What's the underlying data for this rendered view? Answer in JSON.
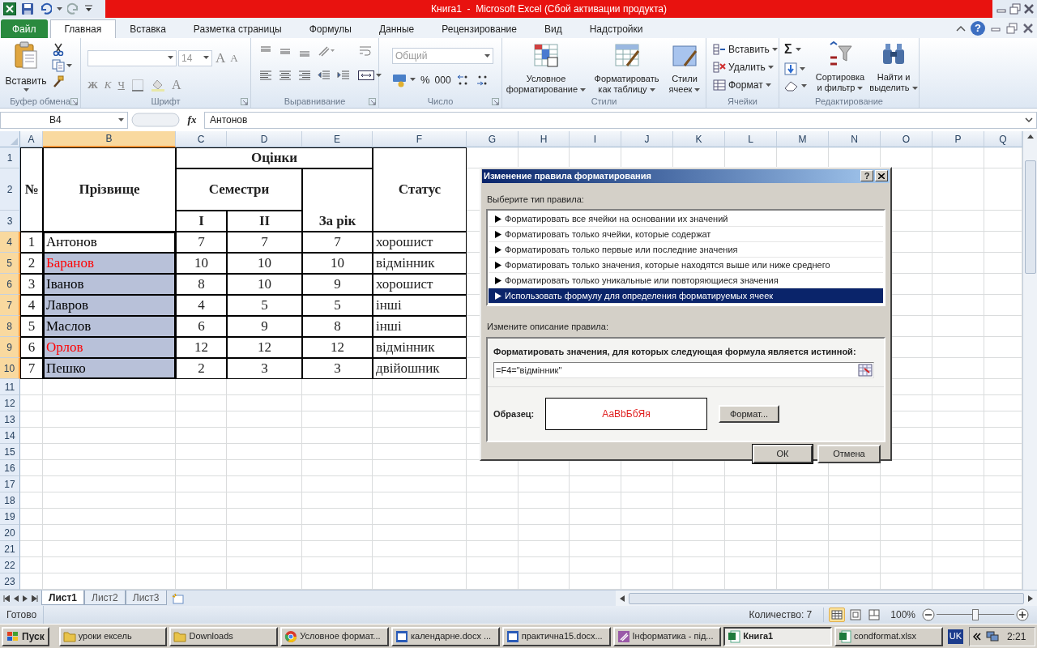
{
  "window": {
    "title": "Книга1  -  Microsoft Excel (Сбой активации продукта)"
  },
  "tabs": [
    {
      "label": "Файл",
      "kind": "file",
      "selected": false
    },
    {
      "label": "Главная",
      "kind": "tab",
      "selected": true
    },
    {
      "label": "Вставка",
      "kind": "tab",
      "selected": false
    },
    {
      "label": "Разметка страницы",
      "kind": "tab",
      "selected": false
    },
    {
      "label": "Формулы",
      "kind": "tab",
      "selected": false
    },
    {
      "label": "Данные",
      "kind": "tab",
      "selected": false
    },
    {
      "label": "Рецензирование",
      "kind": "tab",
      "selected": false
    },
    {
      "label": "Вид",
      "kind": "tab",
      "selected": false
    },
    {
      "label": "Надстройки",
      "kind": "tab",
      "selected": false
    }
  ],
  "ribbon": {
    "groups": [
      {
        "kind": "clipboard",
        "label": "Буфер обмена",
        "paste": "Вставить"
      },
      {
        "kind": "font",
        "label": "Шрифт",
        "size": "14",
        "grow": "A",
        "shrink": "A",
        "bold": "Ж",
        "italic": "К",
        "underline": "Ч",
        "font_color": "A"
      },
      {
        "kind": "alignment",
        "label": "Выравнивание"
      },
      {
        "kind": "number",
        "label": "Число",
        "format": "Общий",
        "percent": "%",
        "thousands": "000"
      },
      {
        "kind": "styles",
        "label": "Стили",
        "conditional": "Условное форматирование",
        "as_table": "Форматировать как таблицу",
        "cell_styles": "Стили ячеек"
      },
      {
        "kind": "cells",
        "label": "Ячейки",
        "insert": "Вставить",
        "delete": "Удалить",
        "format": "Формат"
      },
      {
        "kind": "editing",
        "label": "Редактирование",
        "autosum": "Σ",
        "sort": "Сортировка и фильтр",
        "find": "Найти и выделить"
      }
    ]
  },
  "formula_bar": {
    "name_box": "B4",
    "function_button": "fx",
    "formula": "Антонов"
  },
  "sheet": {
    "columns": [
      {
        "label": "A",
        "selected": false
      },
      {
        "label": "B",
        "selected": true
      },
      {
        "label": "C",
        "selected": false
      },
      {
        "label": "D",
        "selected": false
      },
      {
        "label": "E",
        "selected": false
      },
      {
        "label": "F",
        "selected": false
      },
      {
        "label": "G",
        "selected": false
      },
      {
        "label": "H",
        "selected": false
      },
      {
        "label": "I",
        "selected": false
      },
      {
        "label": "J",
        "selected": false
      },
      {
        "label": "K",
        "selected": false
      },
      {
        "label": "L",
        "selected": false
      },
      {
        "label": "M",
        "selected": false
      },
      {
        "label": "N",
        "selected": false
      },
      {
        "label": "O",
        "selected": false
      },
      {
        "label": "P",
        "selected": false
      },
      {
        "label": "Q",
        "selected": false
      }
    ],
    "rows": [
      {
        "label": "1",
        "selected": false
      },
      {
        "label": "2",
        "selected": false
      },
      {
        "label": "3",
        "selected": false
      },
      {
        "label": "4",
        "selected": true
      },
      {
        "label": "5",
        "selected": true
      },
      {
        "label": "6",
        "selected": true
      },
      {
        "label": "7",
        "selected": true
      },
      {
        "label": "8",
        "selected": true
      },
      {
        "label": "9",
        "selected": true
      },
      {
        "label": "10",
        "selected": true
      },
      {
        "label": "11",
        "selected": false
      },
      {
        "label": "12",
        "selected": false
      },
      {
        "label": "13",
        "selected": false
      },
      {
        "label": "14",
        "selected": false
      },
      {
        "label": "15",
        "selected": false
      },
      {
        "label": "16",
        "selected": false
      },
      {
        "label": "17",
        "selected": false
      },
      {
        "label": "18",
        "selected": false
      },
      {
        "label": "19",
        "selected": false
      },
      {
        "label": "20",
        "selected": false
      },
      {
        "label": "21",
        "selected": false
      },
      {
        "label": "22",
        "selected": false
      },
      {
        "label": "23",
        "selected": false
      }
    ],
    "table": {
      "number_header": "№",
      "surname_header": "Прізвище",
      "grades_header": "Оцінки",
      "semesters_header": "Семестри",
      "semester_columns": [
        "I",
        "II"
      ],
      "year_header": "За рік",
      "status_header": "Статус",
      "records": [
        {
          "number": "1",
          "surname": "Антонов",
          "selected": true,
          "active": true,
          "formatted": false,
          "semester_1": "7",
          "semester_2": "7",
          "year": "7",
          "status": "хорошист"
        },
        {
          "number": "2",
          "surname": "Баранов",
          "selected": true,
          "active": false,
          "formatted": true,
          "semester_1": "10",
          "semester_2": "10",
          "year": "10",
          "status": "відмінник"
        },
        {
          "number": "3",
          "surname": "Іванов",
          "selected": true,
          "active": false,
          "formatted": false,
          "semester_1": "8",
          "semester_2": "10",
          "year": "9",
          "status": "хорошист"
        },
        {
          "number": "4",
          "surname": "Лавров",
          "selected": true,
          "active": false,
          "formatted": false,
          "semester_1": "4",
          "semester_2": "5",
          "year": "5",
          "status": "інші"
        },
        {
          "number": "5",
          "surname": "Маслов",
          "selected": true,
          "active": false,
          "formatted": false,
          "semester_1": "6",
          "semester_2": "9",
          "year": "8",
          "status": "інші"
        },
        {
          "number": "6",
          "surname": "Орлов",
          "selected": true,
          "active": false,
          "formatted": true,
          "semester_1": "12",
          "semester_2": "12",
          "year": "12",
          "status": "відмінник"
        },
        {
          "number": "7",
          "surname": "Пешко",
          "selected": true,
          "active": false,
          "formatted": false,
          "semester_1": "2",
          "semester_2": "3",
          "year": "3",
          "status": "двійошник"
        }
      ]
    },
    "sheet_tabs": [
      {
        "label": "Лист1",
        "selected": true
      },
      {
        "label": "Лист2",
        "selected": false
      },
      {
        "label": "Лист3",
        "selected": false
      }
    ]
  },
  "dialog": {
    "title": "Изменение правила форматирования",
    "help_button": "?",
    "rule_type_label": "Выберите тип правила:",
    "rule_types": [
      {
        "label": "Форматировать все ячейки на основании их значений",
        "selected": false
      },
      {
        "label": "Форматировать только ячейки, которые содержат",
        "selected": false
      },
      {
        "label": "Форматировать только первые или последние значения",
        "selected": false
      },
      {
        "label": "Форматировать только значения, которые находятся выше или ниже среднего",
        "selected": false
      },
      {
        "label": "Форматировать только уникальные или повторяющиеся значения",
        "selected": false
      },
      {
        "label": "Использовать формулу для определения форматируемых ячеек",
        "selected": true
      }
    ],
    "description_label": "Измените описание правила:",
    "formula_label": "Форматировать значения, для которых следующая формула является истинной:",
    "formula": "=F4=\"відмінник\"",
    "preview_label": "Образец:",
    "preview_text": "АаBbБбЯя",
    "format_button": "Формат...",
    "ok_button": "ОК",
    "cancel_button": "Отмена"
  },
  "status_bar": {
    "status": "Готово",
    "count": "Количество: 7",
    "views": [
      {
        "kind": "normal",
        "selected": true
      },
      {
        "kind": "layout",
        "selected": false
      },
      {
        "kind": "page_break",
        "selected": false
      }
    ],
    "zoom": "100%",
    "zoom_slider": {
      "level": 0.5
    }
  },
  "taskbar": {
    "start": "Пуск",
    "items": [
      {
        "label": "уроки ексель",
        "kind": "folder",
        "selected": false
      },
      {
        "label": "Downloads",
        "kind": "folder",
        "selected": false
      },
      {
        "label": "Условное формат...",
        "kind": "browser",
        "selected": false
      },
      {
        "label": "календарне.docx ...",
        "kind": "word",
        "selected": false
      },
      {
        "label": "практична15.docx...",
        "kind": "word",
        "selected": false
      },
      {
        "label": "Інформатика - під...",
        "kind": "app",
        "selected": false
      },
      {
        "label": "Книга1",
        "kind": "excel",
        "selected": true
      },
      {
        "label": "condformat.xlsx",
        "kind": "excel",
        "selected": false
      }
    ],
    "language": "UK",
    "clock": "2:21"
  }
}
